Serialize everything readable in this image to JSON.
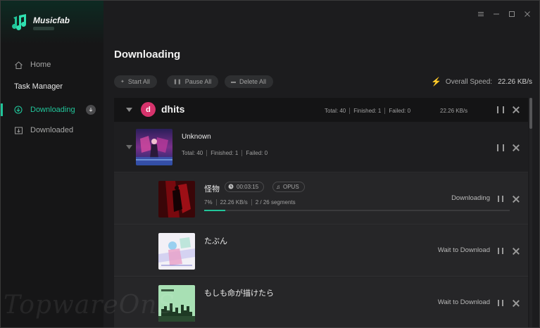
{
  "app": {
    "brand": "Musicfab"
  },
  "window_controls": [
    "menu-icon",
    "minimize-icon",
    "maximize-icon",
    "close-icon"
  ],
  "sidebar": {
    "home": "Home",
    "task_manager": "Task Manager",
    "downloading": "Downloading",
    "downloaded": "Downloaded"
  },
  "main": {
    "title": "Downloading",
    "toolbar": {
      "start_all": "Start All",
      "pause_all": "Pause All",
      "delete_all": "Delete All"
    },
    "overall_speed_label": "Overall Speed:",
    "overall_speed_value": "22.26 KB/s"
  },
  "group": {
    "avatar_letter": "d",
    "name": "dhits",
    "total": "Total: 40",
    "finished": "Finished: 1",
    "failed": "Failed: 0",
    "speed": "22.26 KB/s"
  },
  "album": {
    "name": "Unknown",
    "total": "Total: 40",
    "finished": "Finished: 1",
    "failed": "Failed: 0"
  },
  "tracks": [
    {
      "title": "怪物",
      "duration": "00:03:15",
      "format": "OPUS",
      "percent": "7%",
      "speed": "22.26 KB/s",
      "segments": "2 / 26 segments",
      "progress": 0.07,
      "status": "Downloading"
    },
    {
      "title": "たぶん",
      "status": "Wait to Download"
    },
    {
      "title": "もしも命が描けたら",
      "status": "Wait to Download"
    }
  ],
  "colors": {
    "accent": "#21c59a",
    "avatar": "#d6336c"
  },
  "watermark": "TopwareOnS"
}
